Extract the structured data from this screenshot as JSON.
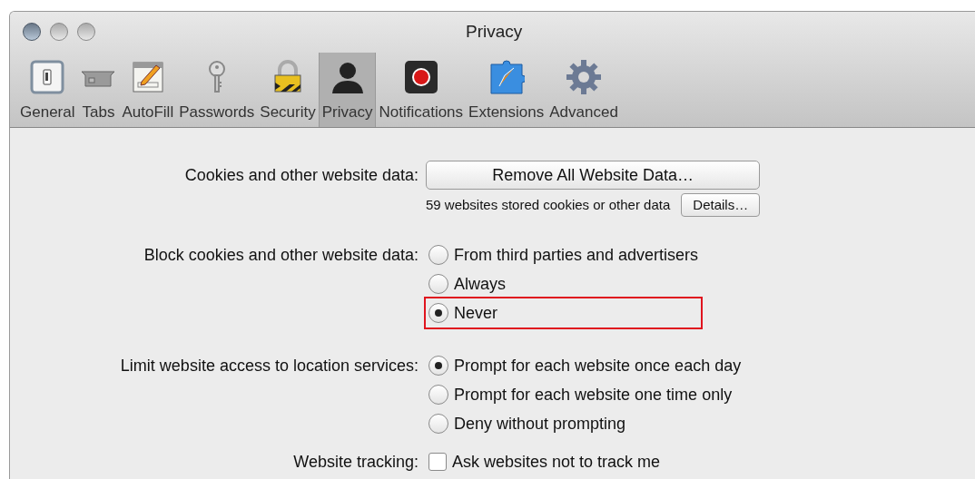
{
  "window": {
    "title": "Privacy"
  },
  "toolbar": [
    {
      "label": "General",
      "selected": false
    },
    {
      "label": "Tabs",
      "selected": false
    },
    {
      "label": "AutoFill",
      "selected": false
    },
    {
      "label": "Passwords",
      "selected": false
    },
    {
      "label": "Security",
      "selected": false
    },
    {
      "label": "Privacy",
      "selected": true
    },
    {
      "label": "Notifications",
      "selected": false
    },
    {
      "label": "Extensions",
      "selected": false
    },
    {
      "label": "Advanced",
      "selected": false
    }
  ],
  "cookies": {
    "label": "Cookies and other website data:",
    "button": "Remove All Website Data…",
    "note": "59 websites stored cookies or other data",
    "details_button": "Details…"
  },
  "block_cookies": {
    "label": "Block cookies and other website data:",
    "options": [
      {
        "label": "From third parties and advertisers",
        "selected": false,
        "highlighted": false
      },
      {
        "label": "Always",
        "selected": false,
        "highlighted": false
      },
      {
        "label": "Never",
        "selected": true,
        "highlighted": true
      }
    ]
  },
  "location": {
    "label": "Limit website access to location services:",
    "options": [
      {
        "label": "Prompt for each website once each day",
        "selected": true,
        "highlighted": false
      },
      {
        "label": "Prompt for each website one time only",
        "selected": false,
        "highlighted": false
      },
      {
        "label": "Deny without prompting",
        "selected": false,
        "highlighted": false
      }
    ]
  },
  "tracking": {
    "label": "Website tracking:",
    "checkbox": {
      "label": "Ask websites not to track me",
      "checked": false
    }
  }
}
